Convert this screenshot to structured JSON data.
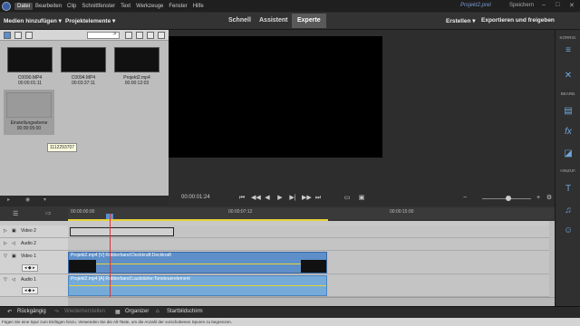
{
  "menubar": {
    "items": [
      "Datei",
      "Bearbeiten",
      "Clip",
      "Schnittfenster",
      "Text",
      "Werkzeuge",
      "Fenster",
      "Hilfe"
    ],
    "project_title": "Projekt2.prel",
    "save_label": "Speichern"
  },
  "modebar": {
    "add_media": "Medien hinzufügen",
    "project_assets": "Projektelemente",
    "modes": [
      "Schnell",
      "Assistent",
      "Experte"
    ],
    "create": "Erstellen",
    "export_share": "Exportieren und freigeben"
  },
  "organizer": {
    "clips": [
      {
        "name": "C0090.MP4",
        "duration": "00:00:01:11"
      },
      {
        "name": "C0094.MP4",
        "duration": "00:03:37:11"
      },
      {
        "name": "Projekt2.mp4",
        "duration": "00:00:12:03"
      },
      {
        "name": "Einstellungsebene",
        "duration": "00:00:05:00"
      }
    ],
    "tooltip": "1112293707"
  },
  "transport": {
    "timecode": "00:00:01:24"
  },
  "rightpanel": {
    "labels": [
      "KORRIG.",
      "BEARB.",
      "HINZUF."
    ]
  },
  "timeline": {
    "ruler": [
      "00:00:00:00",
      "00:00:07:12",
      "00:00:15:00"
    ],
    "tracks": [
      {
        "name": "Video 2"
      },
      {
        "name": "Audio 2"
      },
      {
        "name": "Video 1"
      },
      {
        "name": "Audio 1"
      }
    ],
    "video_clip_label": "Projekt2.mp4 [V] Rubberband:Deckkraft:Deckkraft",
    "audio_clip_label": "Projekt2.mp4 [A] Rubberband:Lautstärke:Tonsteuerelement"
  },
  "actionbar": {
    "undo": "Rückgängig",
    "redo": "Wiederherstellen",
    "organizer": "Organizer",
    "home": "Startbildschirm"
  },
  "status": "Fügen Sie eine Spur zum Einfügen hinzu. Verwenden Sie die Alt-Taste, um die Anzahl der vorschobenen Spuren zu begrenzen."
}
